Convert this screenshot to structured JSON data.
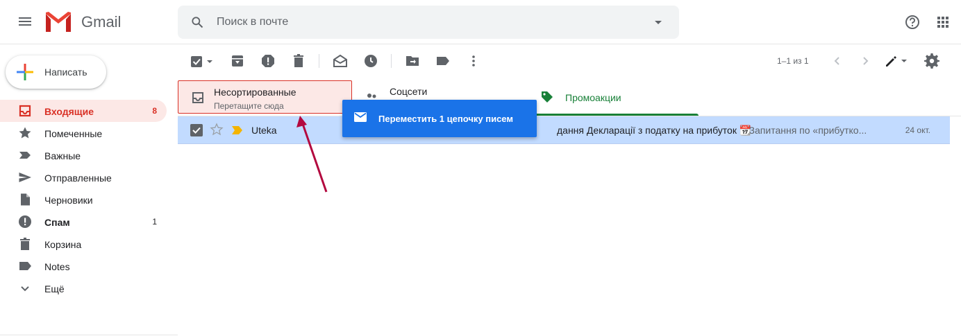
{
  "app": {
    "title": "Gmail"
  },
  "search": {
    "placeholder": "Поиск в почте"
  },
  "compose": {
    "label": "Написать"
  },
  "sidebar": {
    "items": [
      {
        "label": "Входящие",
        "count": "8",
        "icon": "inbox-icon"
      },
      {
        "label": "Помеченные",
        "count": "",
        "icon": "star-icon"
      },
      {
        "label": "Важные",
        "count": "",
        "icon": "important-icon"
      },
      {
        "label": "Отправленные",
        "count": "",
        "icon": "send-icon"
      },
      {
        "label": "Черновики",
        "count": "",
        "icon": "draft-icon"
      },
      {
        "label": "Спам",
        "count": "1",
        "icon": "spam-icon"
      },
      {
        "label": "Корзина",
        "count": "",
        "icon": "trash-icon"
      },
      {
        "label": "Notes",
        "count": "",
        "icon": "label-icon"
      },
      {
        "label": "Ещё",
        "count": "",
        "icon": "chevron-down-icon"
      }
    ]
  },
  "toolbar": {
    "page_info": "1–1 из 1"
  },
  "tabs": {
    "primary": {
      "title": "Несортированные",
      "subtitle": "Перетащите сюда"
    },
    "social": {
      "title": "Соцсети"
    },
    "promotions": {
      "title": "Промоакции"
    }
  },
  "email": {
    "sender": "Uteka",
    "subject": "дання Декларації з податку на прибуток 📆",
    "snippet": " - Запитання по «прибутко...",
    "date": "24 окт."
  },
  "drag_tooltip": {
    "label": "Переместить 1 цепочку писем"
  },
  "colors": {
    "accent_red": "#d93025",
    "selection_blue": "#c2dbff",
    "drag_blue": "#1a73e8",
    "promo_green": "#188038"
  }
}
